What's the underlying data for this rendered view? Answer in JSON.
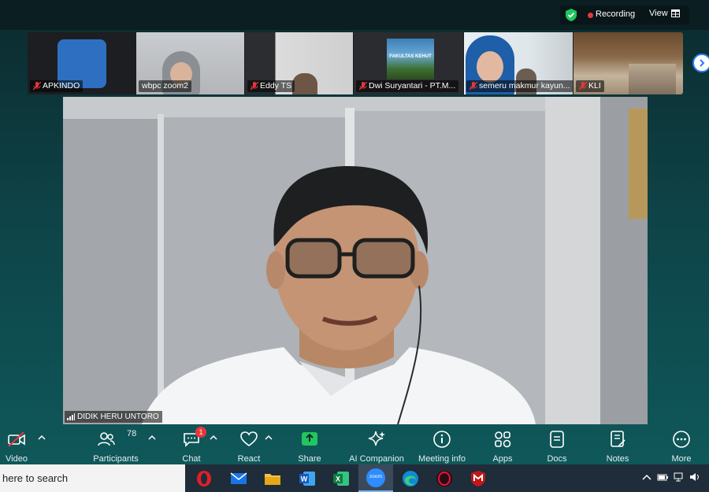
{
  "status_bar": {
    "recording_label": "Recording",
    "view_label": "View"
  },
  "participants": [
    {
      "name": "APKINDO"
    },
    {
      "name": "wbpc zoom2"
    },
    {
      "name": "Eddy TS"
    },
    {
      "name": "Dwi Suryantari - PT.M..."
    },
    {
      "name": "semeru makmur kayun..."
    },
    {
      "name": "KLI"
    }
  ],
  "banner_text": "FAKULTAS KEHUT",
  "main_video": {
    "speaker_name": "DIDIK HERU UNTORO"
  },
  "toolbar": {
    "video": "Video",
    "participants": "Participants",
    "participant_count": "78",
    "chat": "Chat",
    "chat_badge": "1",
    "react": "React",
    "share": "Share",
    "ai_companion": "AI Companion",
    "meeting_info": "Meeting info",
    "apps": "Apps",
    "docs": "Docs",
    "notes": "Notes",
    "more": "More"
  },
  "taskbar": {
    "search_placeholder": "here to search",
    "zoom_label": "zoom"
  },
  "colors": {
    "accent_green": "#22c55e",
    "record_red": "#e8363b",
    "apkindo_blue": "#2f6fc2"
  }
}
